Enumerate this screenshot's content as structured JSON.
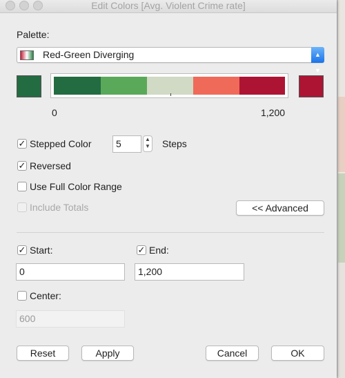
{
  "window": {
    "title": "Edit Colors [Avg. Violent Crime rate]"
  },
  "palette": {
    "label": "Palette:",
    "selected": "Red-Green Diverging"
  },
  "ramp": {
    "start_color": "#236b41",
    "end_color": "#ad1433",
    "colors": [
      "#236b41",
      "#5aa95a",
      "#d0dac4",
      "#f06a5a",
      "#ad1433"
    ],
    "min_label": "0",
    "max_label": "1,200"
  },
  "options": {
    "stepped_color": {
      "label": "Stepped Color",
      "checked": true
    },
    "steps_value": "5",
    "steps_label": "Steps",
    "reversed": {
      "label": "Reversed",
      "checked": true
    },
    "full_range": {
      "label": "Use Full Color Range",
      "checked": false
    },
    "include_totals": {
      "label": "Include Totals",
      "checked": false,
      "enabled": false
    },
    "advanced_label": "<< Advanced"
  },
  "range": {
    "start_label": "Start:",
    "start_checked": true,
    "start_value": "0",
    "end_label": "End:",
    "end_checked": true,
    "end_value": "1,200",
    "center_label": "Center:",
    "center_checked": false,
    "center_value": "600"
  },
  "buttons": {
    "reset": "Reset",
    "apply": "Apply",
    "cancel": "Cancel",
    "ok": "OK"
  }
}
